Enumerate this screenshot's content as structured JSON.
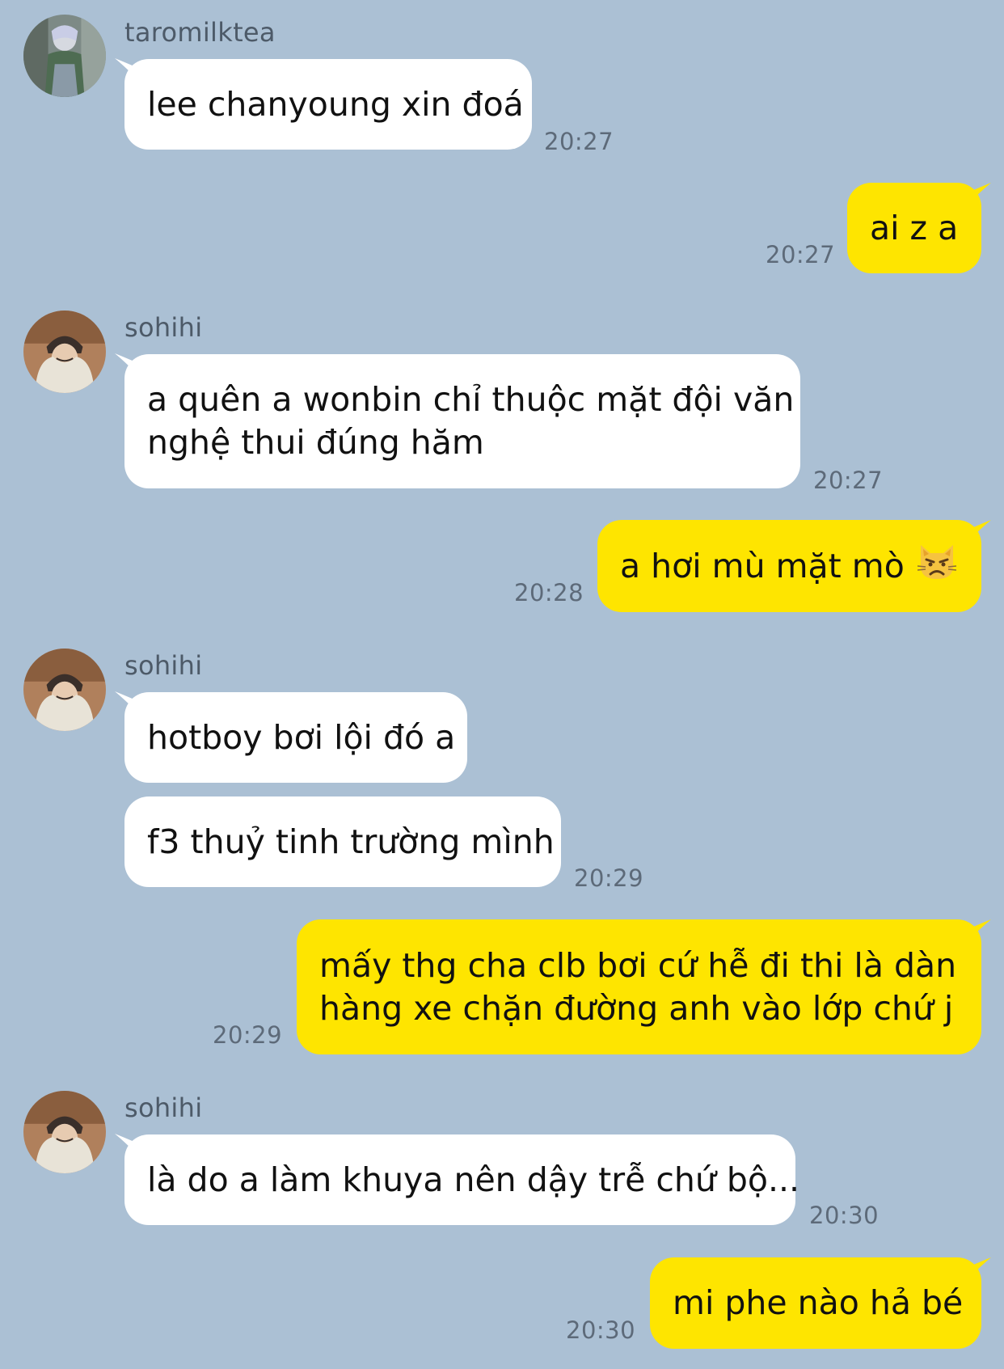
{
  "colors": {
    "background": "#abc0d4",
    "incoming_bubble": "#ffffff",
    "outgoing_bubble": "#fee500",
    "timestamp": "#5d6a79"
  },
  "messages": [
    {
      "sender": "taromilktea",
      "avatar": "avatar-taromilktea",
      "text": "lee chanyoung xin đoá",
      "time": "20:27"
    },
    {
      "direction": "out",
      "text": "ai z a",
      "time": "20:27"
    },
    {
      "sender": "sohihi",
      "avatar": "avatar-sohihi",
      "line1": "a quên a wonbin chỉ thuộc mặt đội văn",
      "line2": "nghệ thui đúng hăm",
      "time": "20:27"
    },
    {
      "direction": "out",
      "text": "a hơi mù mặt mò",
      "emoji": "pouting-cat-icon",
      "time": "20:28"
    },
    {
      "sender": "sohihi",
      "avatar": "avatar-sohihi",
      "text": "hotboy bơi lội đó a"
    },
    {
      "text": "f3 thuỷ tinh trường mình",
      "time": "20:29"
    },
    {
      "direction": "out",
      "line1": "mấy thg cha clb bơi cứ hễ đi thi là dàn",
      "line2": "hàng xe chặn đường anh vào lớp chứ j",
      "time": "20:29"
    },
    {
      "sender": "sohihi",
      "avatar": "avatar-sohihi",
      "text": "là do a làm khuya nên dậy trễ chứ bộ...",
      "time": "20:30"
    },
    {
      "direction": "out",
      "text": "mi phe nào hả bé",
      "time": "20:30"
    }
  ]
}
